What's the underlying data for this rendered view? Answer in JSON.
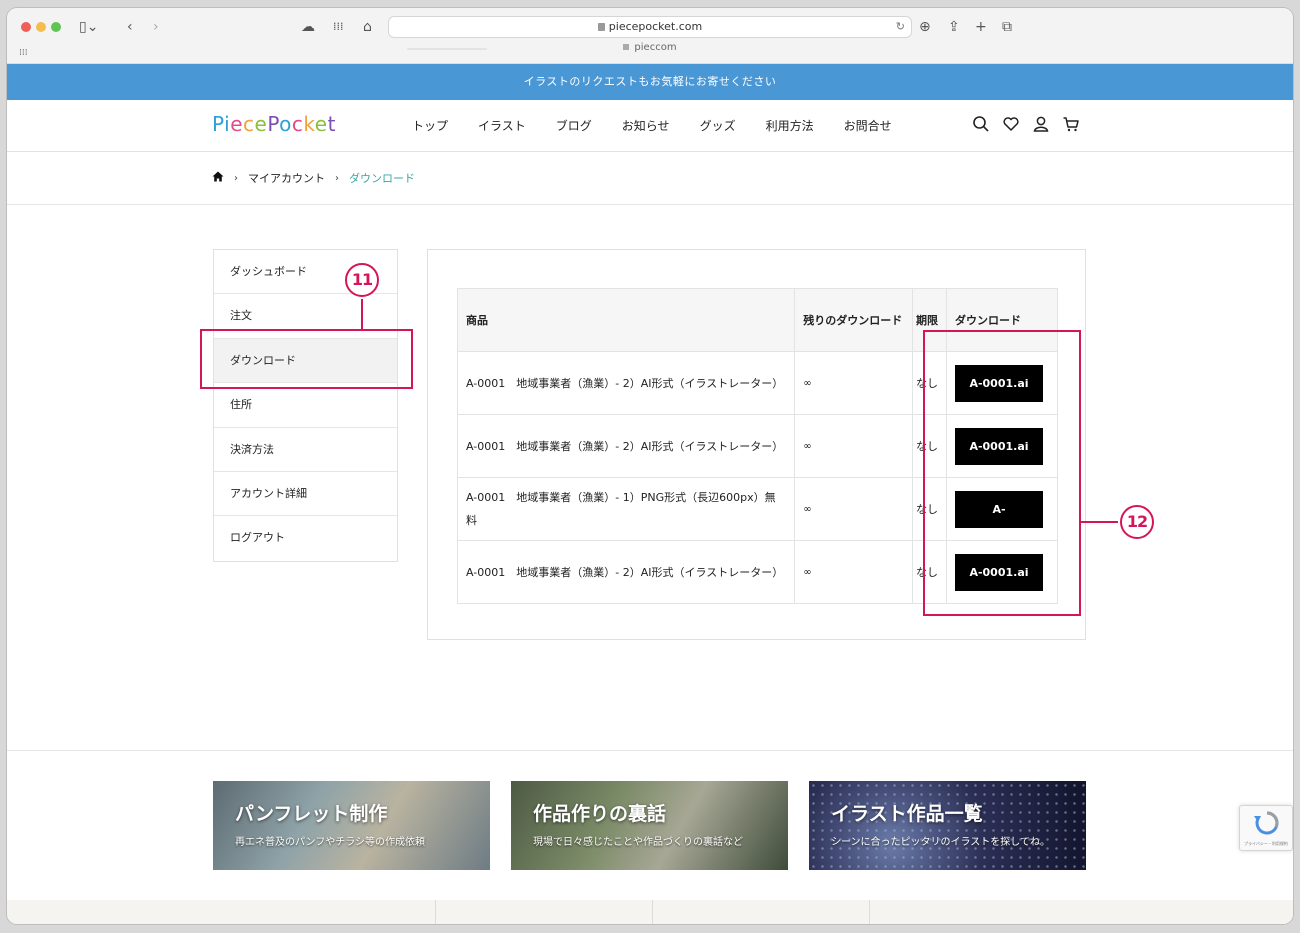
{
  "browser": {
    "url": "piecepocket.com",
    "tab_title": "pieccom"
  },
  "announce": {
    "text": "イラストのリクエストもお気軽にお寄せください"
  },
  "header": {
    "logo": [
      "P",
      "i",
      "e",
      "c",
      "e",
      "P",
      "o",
      "c",
      "k",
      "e",
      "t"
    ],
    "nav": [
      "トップ",
      "イラスト",
      "ブログ",
      "お知らせ",
      "グッズ",
      "利用方法",
      "お問合せ"
    ]
  },
  "breadcrumb": {
    "level1": "マイアカウント",
    "current": "ダウンロード"
  },
  "sidebar": {
    "items": [
      "ダッシュボード",
      "注文",
      "ダウンロード",
      "住所",
      "決済方法",
      "アカウント詳細",
      "ログアウト"
    ],
    "active_index": 2
  },
  "table": {
    "headers": {
      "product": "商品",
      "remaining": "残りのダウンロード",
      "expires": "期限",
      "download": "ダウンロード"
    },
    "rows": [
      {
        "product": "A-0001　地域事業者（漁業）- 2）AI形式（イラストレーター）",
        "remaining": "∞",
        "expires": "なし",
        "button": "A-0001.ai"
      },
      {
        "product": "A-0001　地域事業者（漁業）- 2）AI形式（イラストレーター）",
        "remaining": "∞",
        "expires": "なし",
        "button": "A-0001.ai"
      },
      {
        "product": "A-0001　地域事業者（漁業）- 1）PNG形式（長辺600px）無料",
        "remaining": "∞",
        "expires": "なし",
        "button": "A-"
      },
      {
        "product": "A-0001　地域事業者（漁業）- 2）AI形式（イラストレーター）",
        "remaining": "∞",
        "expires": "なし",
        "button": "A-0001.ai"
      }
    ]
  },
  "annotations": {
    "n11": "11",
    "n12": "12"
  },
  "banners": [
    {
      "title": "パンフレット制作",
      "subtitle": "再エネ普及のパンフやチラシ等の作成依頼"
    },
    {
      "title": "作品作りの裏話",
      "subtitle": "現場で日々感じたことや作品づくりの裏話など"
    },
    {
      "title": "イラスト作品一覧",
      "subtitle": "シーンに合ったピッタリのイラストを探してね。"
    }
  ],
  "recaptcha": {
    "text": "プライバシー・利用規約"
  },
  "colors": {
    "announce_bg": "#4a97d6",
    "accent_teal": "#3aa3a3",
    "annotation": "#d4155a",
    "logo_letters": [
      "#2f9fd8",
      "#2f9fd8",
      "#e24a8a",
      "#f0a33a",
      "#8bbf3c",
      "#7a4fb5",
      "#2f9fd8",
      "#e24a8a",
      "#f0a33a",
      "#8bbf3c",
      "#7a4fb5"
    ]
  }
}
